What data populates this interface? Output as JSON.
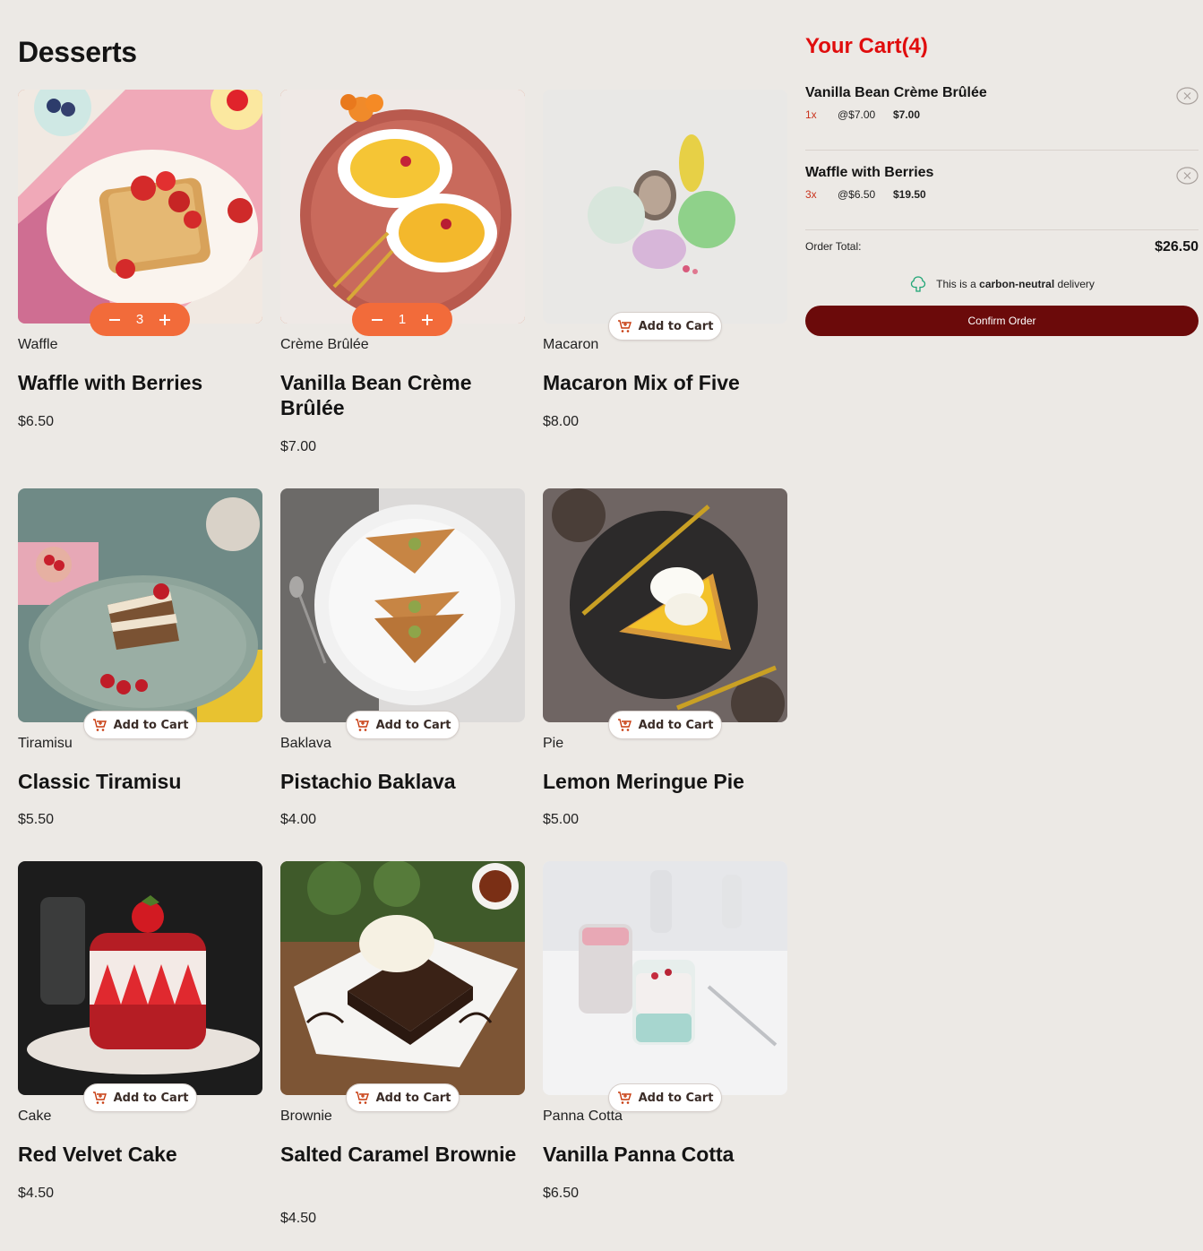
{
  "page": {
    "title": "Desserts"
  },
  "products": [
    {
      "category": "Waffle",
      "name": "Waffle with Berries",
      "price": "$6.50",
      "in_cart": true,
      "quantity": "3",
      "add_label": "Add to Cart"
    },
    {
      "category": "Crème Brûlée",
      "name": "Vanilla Bean Crème Brûlée",
      "price": "$7.00",
      "in_cart": true,
      "quantity": "1",
      "add_label": "Add to Cart"
    },
    {
      "category": "Macaron",
      "name": "Macaron Mix of Five",
      "price": "$8.00",
      "in_cart": false,
      "add_label": "Add to Cart"
    },
    {
      "category": "Tiramisu",
      "name": "Classic Tiramisu",
      "price": "$5.50",
      "in_cart": false,
      "add_label": "Add to Cart"
    },
    {
      "category": "Baklava",
      "name": "Pistachio Baklava",
      "price": "$4.00",
      "in_cart": false,
      "add_label": "Add to Cart"
    },
    {
      "category": "Pie",
      "name": "Lemon Meringue Pie",
      "price": "$5.00",
      "in_cart": false,
      "add_label": "Add to Cart"
    },
    {
      "category": "Cake",
      "name": "Red Velvet Cake",
      "price": "$4.50",
      "in_cart": false,
      "add_label": "Add to Cart"
    },
    {
      "category": "Brownie",
      "name": "Salted Caramel Brownie",
      "price": "$4.50",
      "in_cart": false,
      "add_label": "Add to Cart"
    },
    {
      "category": "Panna Cotta",
      "name": "Vanilla Panna Cotta",
      "price": "$6.50",
      "in_cart": false,
      "add_label": "Add to Cart"
    }
  ],
  "cart": {
    "title": "Your Cart(4)",
    "items": [
      {
        "name": "Vanilla Bean Crème Brûlée",
        "qty": "1x",
        "unit": "@$7.00",
        "total": "$7.00"
      },
      {
        "name": "Waffle with Berries",
        "qty": "3x",
        "unit": "@$6.50",
        "total": "$19.50"
      }
    ],
    "order_total_label": "Order Total:",
    "order_total_value": "$26.50",
    "carbon_prefix": "This is a",
    "carbon_bold": "carbon-neutral",
    "carbon_suffix": "delivery",
    "confirm_label": "Confirm Order"
  },
  "colors": {
    "accent": "#f26b3a",
    "brand_red": "#e00d0d",
    "confirm_bg": "#6b0a0a",
    "background": "#ece9e5"
  },
  "icons": {
    "add_to_cart": "cart-plus-icon",
    "decrement": "minus-icon",
    "increment": "plus-icon",
    "remove": "remove-circle-x-icon",
    "carbon": "tree-icon"
  }
}
